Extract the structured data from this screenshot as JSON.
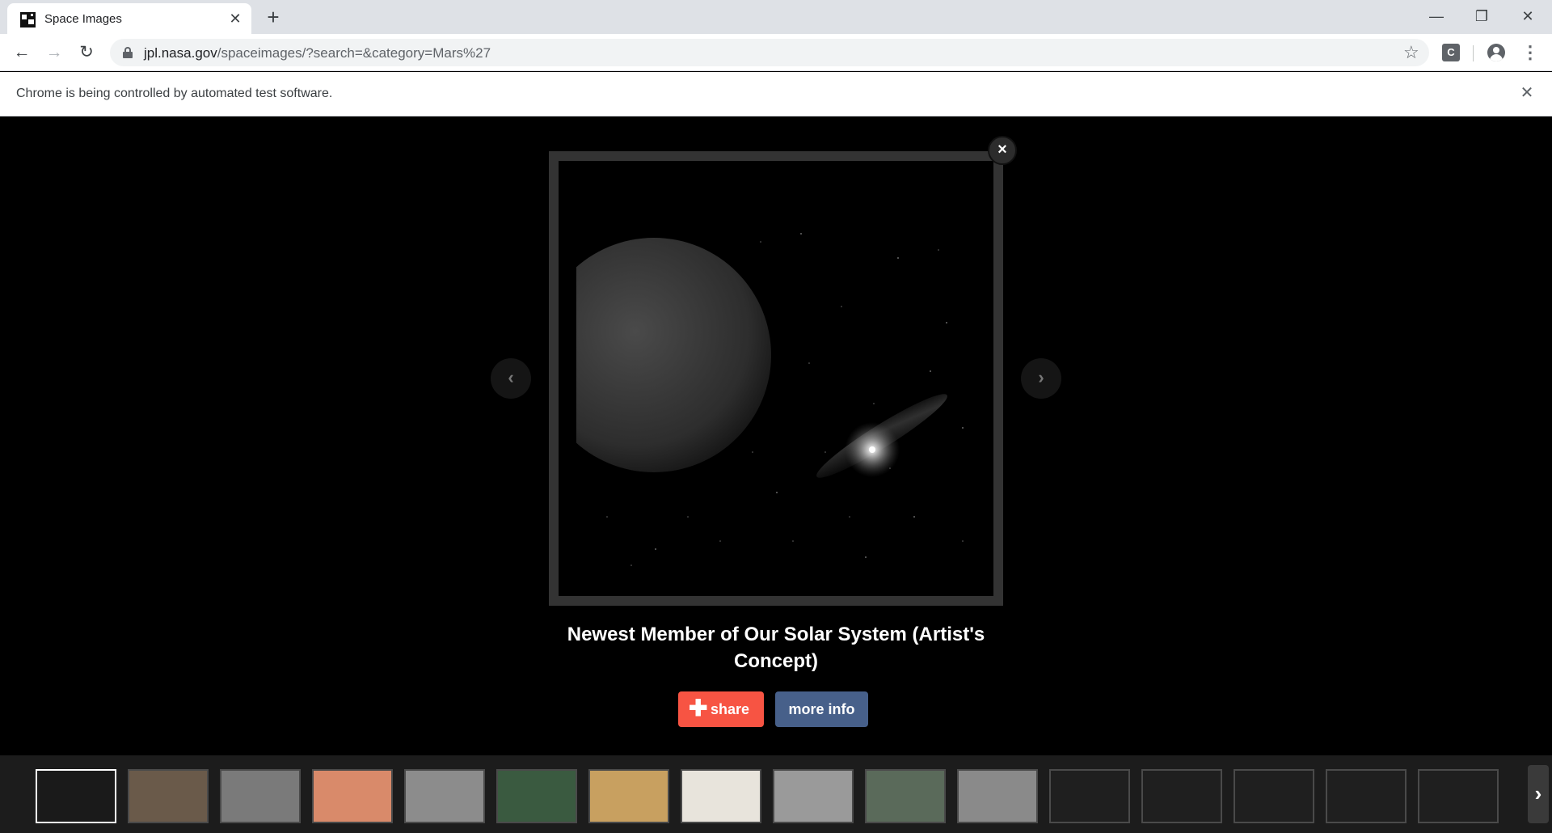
{
  "browser": {
    "tab_title": "Space Images",
    "tab_close_icon": "close-icon",
    "new_tab_glyph": "+",
    "url_host": "jpl.nasa.gov",
    "url_path": "/spaceimages/?search=&category=Mars%27",
    "extension_label": "C",
    "infobar_text": "Chrome is being controlled by automated test software."
  },
  "lightbox": {
    "title": "Newest Member of Our Solar System (Artist's Concept)",
    "share_label": "share",
    "more_info_label": "more info",
    "close_glyph": "×",
    "prev_glyph": "‹",
    "next_glyph": "›"
  },
  "thumbnails": {
    "active_index": 0,
    "items": [
      {
        "name": "planet-artist-concept",
        "color": "#1a1a1a"
      },
      {
        "name": "lab-scene",
        "color": "#6a5a4a"
      },
      {
        "name": "gray-terrain",
        "color": "#7a7a7a"
      },
      {
        "name": "orange-surface",
        "color": "#d98a6a"
      },
      {
        "name": "gray-terrain-2",
        "color": "#8c8c8c"
      },
      {
        "name": "green-map",
        "color": "#3a5a40"
      },
      {
        "name": "thermal-map",
        "color": "#c8a060"
      },
      {
        "name": "continent-map",
        "color": "#e8e4dc"
      },
      {
        "name": "crater-terrain",
        "color": "#9a9a9a"
      },
      {
        "name": "satellite-view",
        "color": "#5a6a5a"
      },
      {
        "name": "gray-strip",
        "color": "#8a8a8a"
      },
      {
        "name": "empty-1",
        "color": "#1f1f1f"
      },
      {
        "name": "empty-2",
        "color": "#1f1f1f"
      },
      {
        "name": "empty-3",
        "color": "#1f1f1f"
      },
      {
        "name": "empty-4",
        "color": "#1f1f1f"
      },
      {
        "name": "empty-5",
        "color": "#1f1f1f"
      }
    ],
    "next_glyph": "›"
  }
}
